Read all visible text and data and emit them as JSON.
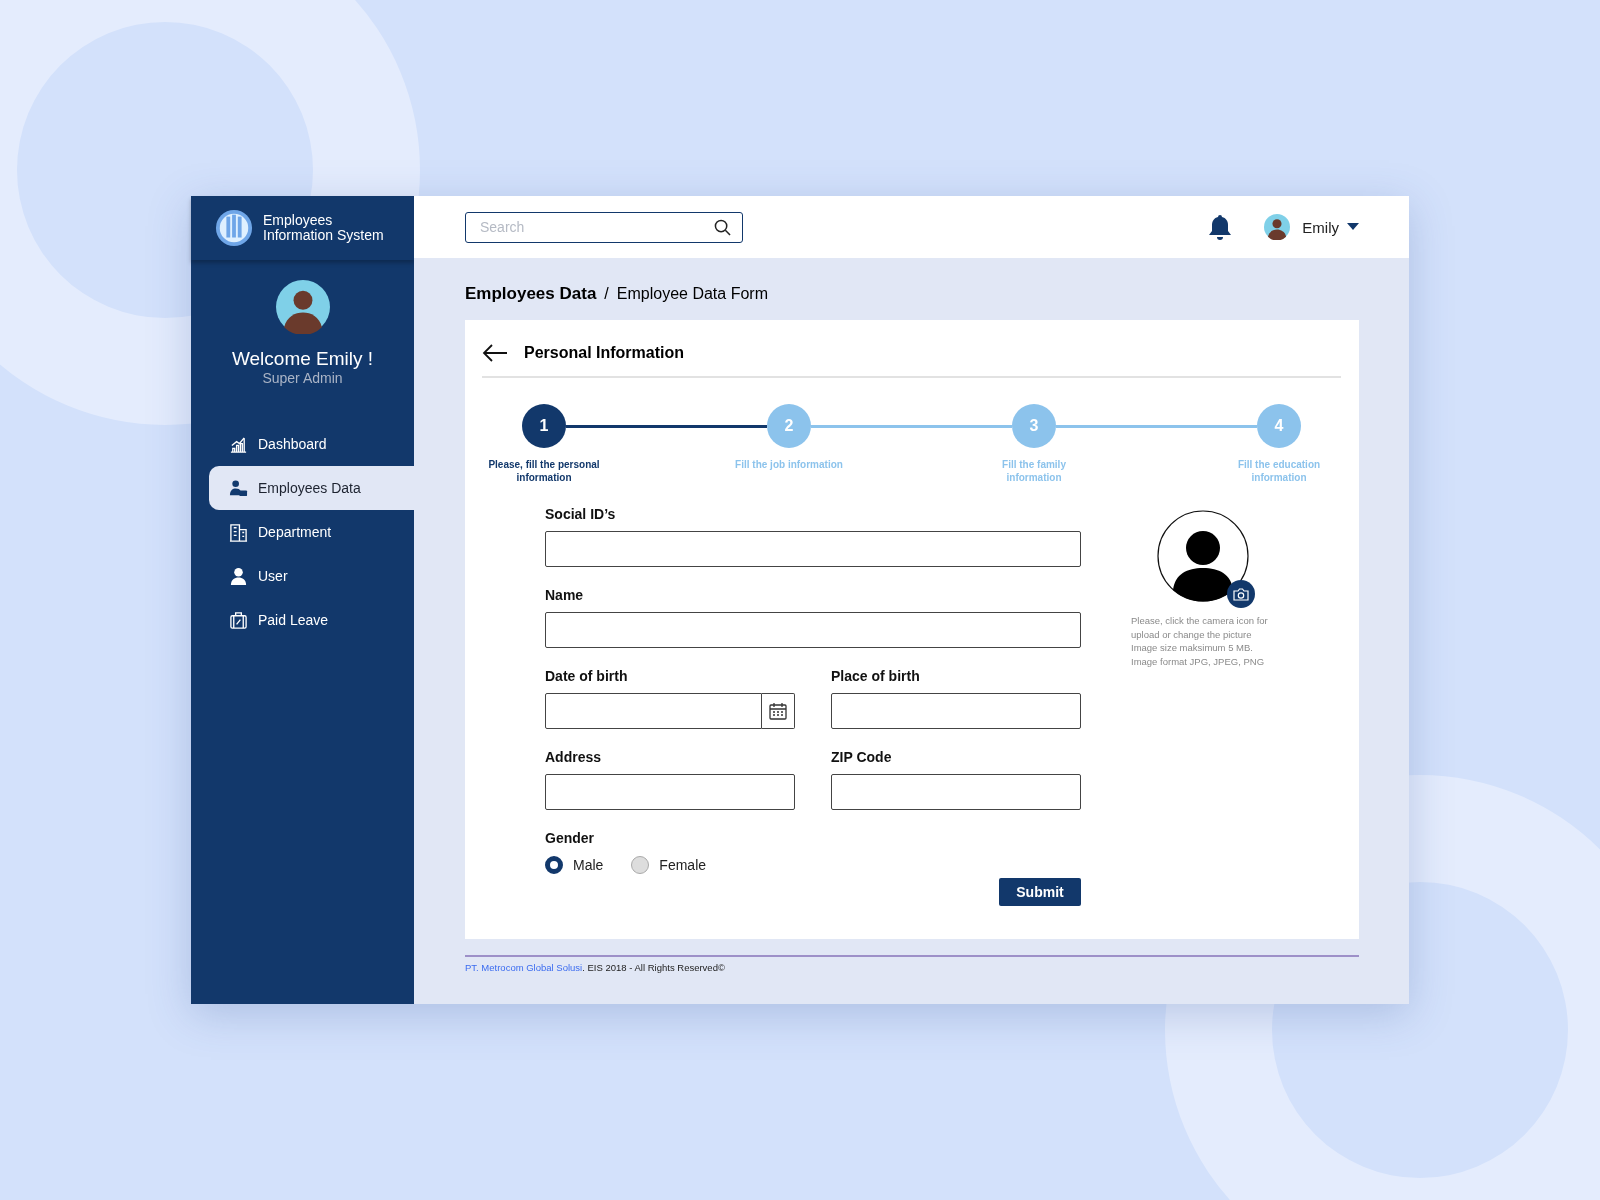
{
  "app": {
    "title": "Employees Information System"
  },
  "sidebar": {
    "welcome": "Welcome Emily !",
    "role": "Super Admin",
    "items": [
      {
        "label": "Dashboard",
        "selected": false
      },
      {
        "label": "Employees Data",
        "selected": true
      },
      {
        "label": "Department",
        "selected": false
      },
      {
        "label": "User",
        "selected": false
      },
      {
        "label": "Paid Leave",
        "selected": false
      }
    ]
  },
  "header": {
    "search": {
      "placeholder": "Search"
    },
    "user": "Emily"
  },
  "breadcrumb": [
    "Employees Data",
    "/",
    "Employee Data Form"
  ],
  "card": {
    "title": "Personal Information",
    "steps": [
      {
        "number": "1",
        "label": "Please, fill the personal information",
        "selected": true
      },
      {
        "number": "2",
        "label": "Fill the job information",
        "selected": false
      },
      {
        "number": "3",
        "label": "Fill the family information",
        "selected": false
      },
      {
        "number": "4",
        "label": "Fill the education information",
        "selected": false
      }
    ],
    "rows": [
      [
        {
          "label": "Social ID’s",
          "kind": "text"
        }
      ],
      [
        {
          "label": "Name",
          "kind": "text"
        }
      ],
      [
        {
          "label": "Date of birth",
          "kind": "date"
        },
        {
          "label": "Place of birth",
          "kind": "text"
        }
      ],
      [
        {
          "label": "Address",
          "kind": "text"
        },
        {
          "label": "ZIP Code",
          "kind": "text"
        }
      ]
    ],
    "gender": {
      "label": "Gender",
      "options": [
        {
          "label": "Male",
          "selected": true
        },
        {
          "label": "Female",
          "selected": false
        }
      ]
    },
    "photo_hint": [
      "Please, click the camera icon for",
      "upload or change the picture",
      "Image size maksimum 5 MB.",
      "Image format JPG, JPEG, PNG"
    ],
    "submit": "Submit"
  },
  "footer": {
    "company": "PT. Metrocom Global Solusi",
    "text": ". EIS 2018 - All Rights Reserved©"
  }
}
